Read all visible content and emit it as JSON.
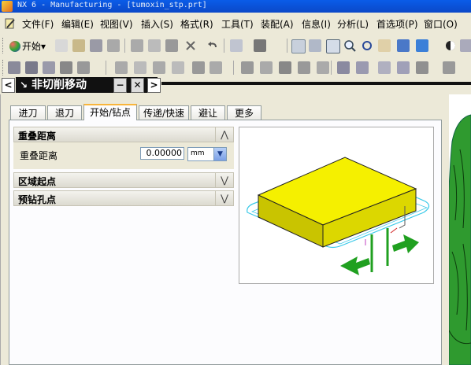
{
  "window": {
    "title": "NX 6 - Manufacturing - [tumoxin_stp.prt]"
  },
  "menubar": {
    "items": [
      "文件(F)",
      "编辑(E)",
      "视图(V)",
      "插入(S)",
      "格式(R)",
      "工具(T)",
      "装配(A)",
      "信息(I)",
      "分析(L)",
      "首选项(P)",
      "窗口(O)"
    ]
  },
  "toolbar1": {
    "start_label": "开始",
    "start_arrow": "▾"
  },
  "nav": {
    "back": "<",
    "title": "非切削移动",
    "minimize": "−",
    "close": "✕",
    "forward": ">"
  },
  "tabs": [
    "进刀",
    "退刀",
    "开始/钻点",
    "传递/快速",
    "避让",
    "更多"
  ],
  "active_tab": 2,
  "sections": {
    "overlap": {
      "title": "重叠距离",
      "chevron": "⋀"
    },
    "region_start": {
      "title": "区域起点",
      "chevron": "⋁"
    },
    "predrill": {
      "title": "预钻孔点",
      "chevron": "⋁"
    }
  },
  "overlap_row": {
    "label": "重叠距离",
    "value": "0.00000",
    "unit": "mm",
    "unit_arrow": "▼"
  },
  "colors": {
    "block_top": "#f5f000",
    "block_side": "#c9c400",
    "path": "#39c9e8",
    "arrow": "#20a020"
  }
}
